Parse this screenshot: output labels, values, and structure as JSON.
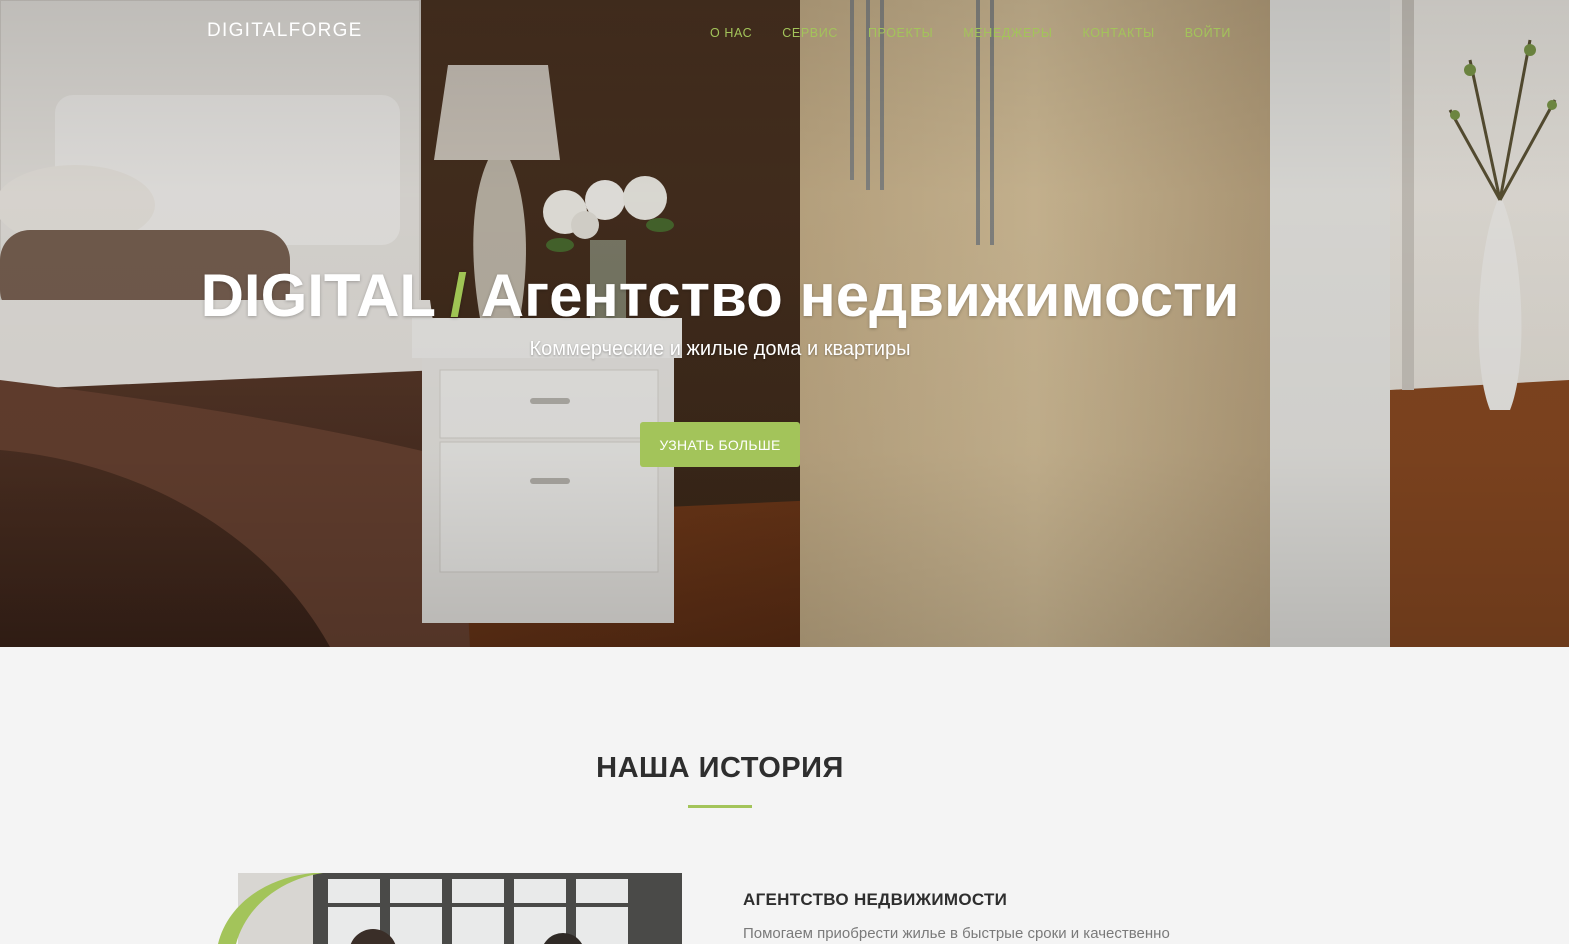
{
  "header": {
    "brand": "DIGITALFORGE",
    "nav": [
      "О НАС",
      "СЕРВИС",
      "ПРОЕКТЫ",
      "МЕНЕДЖЕРЫ",
      "КОНТАКТЫ",
      "ВОЙТИ"
    ]
  },
  "hero": {
    "title_bold": "DIGITAL",
    "title_slash": "/",
    "title_rest": "Агентство недвижимости",
    "subtitle": "Коммерческие и жилые дома и квартиры",
    "cta_label": "УЗНАТЬ БОЛЬШЕ"
  },
  "history": {
    "title": "НАША ИСТОРИЯ",
    "agency_title": "АГЕНТСТВО НЕДВИЖИМОСТИ",
    "agency_text": "Помогаем приобрести жилье в быстрые сроки и качественно"
  },
  "colors": {
    "accent": "#a3c45a",
    "heading": "#2e2e2e",
    "body_text": "#7a7a7a",
    "background": "#f4f4f4"
  }
}
